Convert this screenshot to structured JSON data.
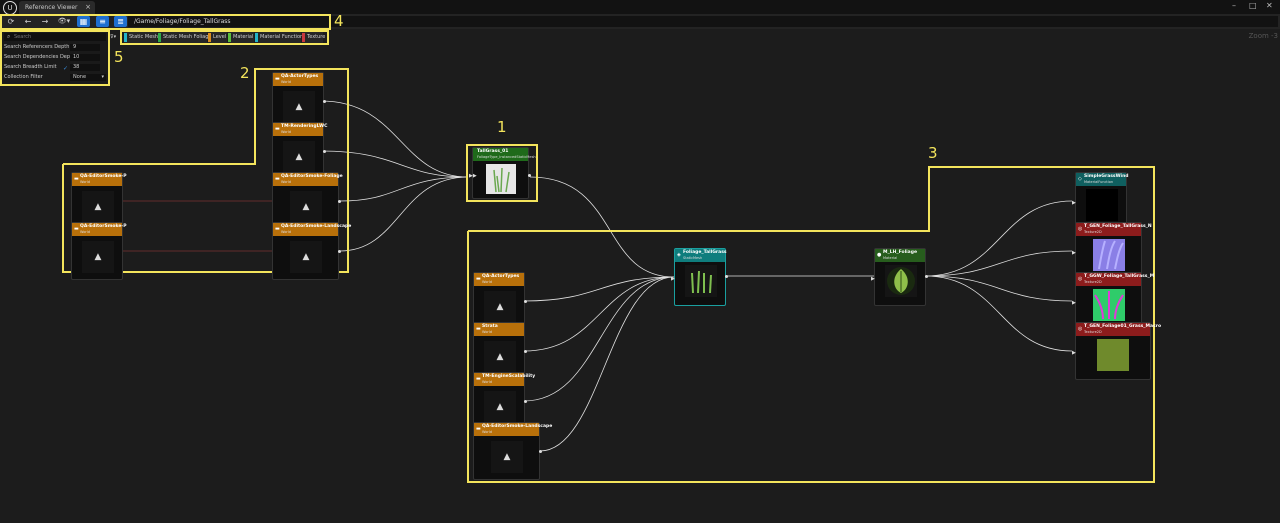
{
  "window": {
    "tab_title": "Reference Viewer",
    "logo": "ue-logo",
    "controls": [
      "–",
      "□",
      "✕"
    ]
  },
  "toolbar": {
    "refresh": "⟳",
    "back": "←",
    "forward": "→",
    "view_options": "👁▾",
    "path": "/Game/Foliage/Foliage_TallGrass"
  },
  "panel": {
    "search_placeholder": "Search",
    "rows": [
      {
        "label": "Search Referencers Depth",
        "value": "9"
      },
      {
        "label": "Search Dependencies Depth",
        "value": "10"
      },
      {
        "label": "Search Breadth Limit",
        "value": "38"
      },
      {
        "label": "Collection Filter",
        "value": "None"
      }
    ]
  },
  "filters": [
    {
      "label": "Static Mesh",
      "color": "#25b3c8"
    },
    {
      "label": "Static Mesh Foliage",
      "color": "#2ea84a"
    },
    {
      "label": "Level",
      "color": "#d98c1f"
    },
    {
      "label": "Material",
      "color": "#5bbd3c"
    },
    {
      "label": "Material Function",
      "color": "#25b3c8"
    },
    {
      "label": "Texture",
      "color": "#c8373d"
    }
  ],
  "zoom": "Zoom -3",
  "annotations": [
    "1",
    "2",
    "3",
    "4",
    "5"
  ],
  "nodes": [
    {
      "title": "QA-ActorTypes",
      "sub": "World"
    },
    {
      "title": "TM-RenderingLWC",
      "sub": "World"
    },
    {
      "title": "QA-EditorSmoke-P",
      "sub": "World"
    },
    {
      "title": "QA-EditorSmoke-Foliage",
      "sub": "World"
    },
    {
      "title": "QA-EditorSmoke-P",
      "sub": "World"
    },
    {
      "title": "QA-EditorSmoke-Landscape",
      "sub": "World"
    },
    {
      "title": "TallGrass_01",
      "sub": "FoliageType_InstancedStaticMesh"
    },
    {
      "title": "QA-ActorTypes",
      "sub": "World"
    },
    {
      "title": "Strata",
      "sub": "World"
    },
    {
      "title": "TM-EngineScalability",
      "sub": "World"
    },
    {
      "title": "QA-EditorSmoke-Landscape",
      "sub": "World"
    },
    {
      "title": "Foliage_TallGrass",
      "sub": "StaticMesh"
    },
    {
      "title": "M_LH_Foliage",
      "sub": "Material"
    },
    {
      "title": "SimpleGrassWind",
      "sub": "MaterialFunction"
    },
    {
      "title": "T_GEN_Foliage_TallGrass_N",
      "sub": "Texture2D"
    },
    {
      "title": "T_GGW_Foliage_TallGrass_M",
      "sub": "Texture2D"
    },
    {
      "title": "T_GEN_Foliage01_Grass_Macro",
      "sub": "Texture2D"
    }
  ]
}
